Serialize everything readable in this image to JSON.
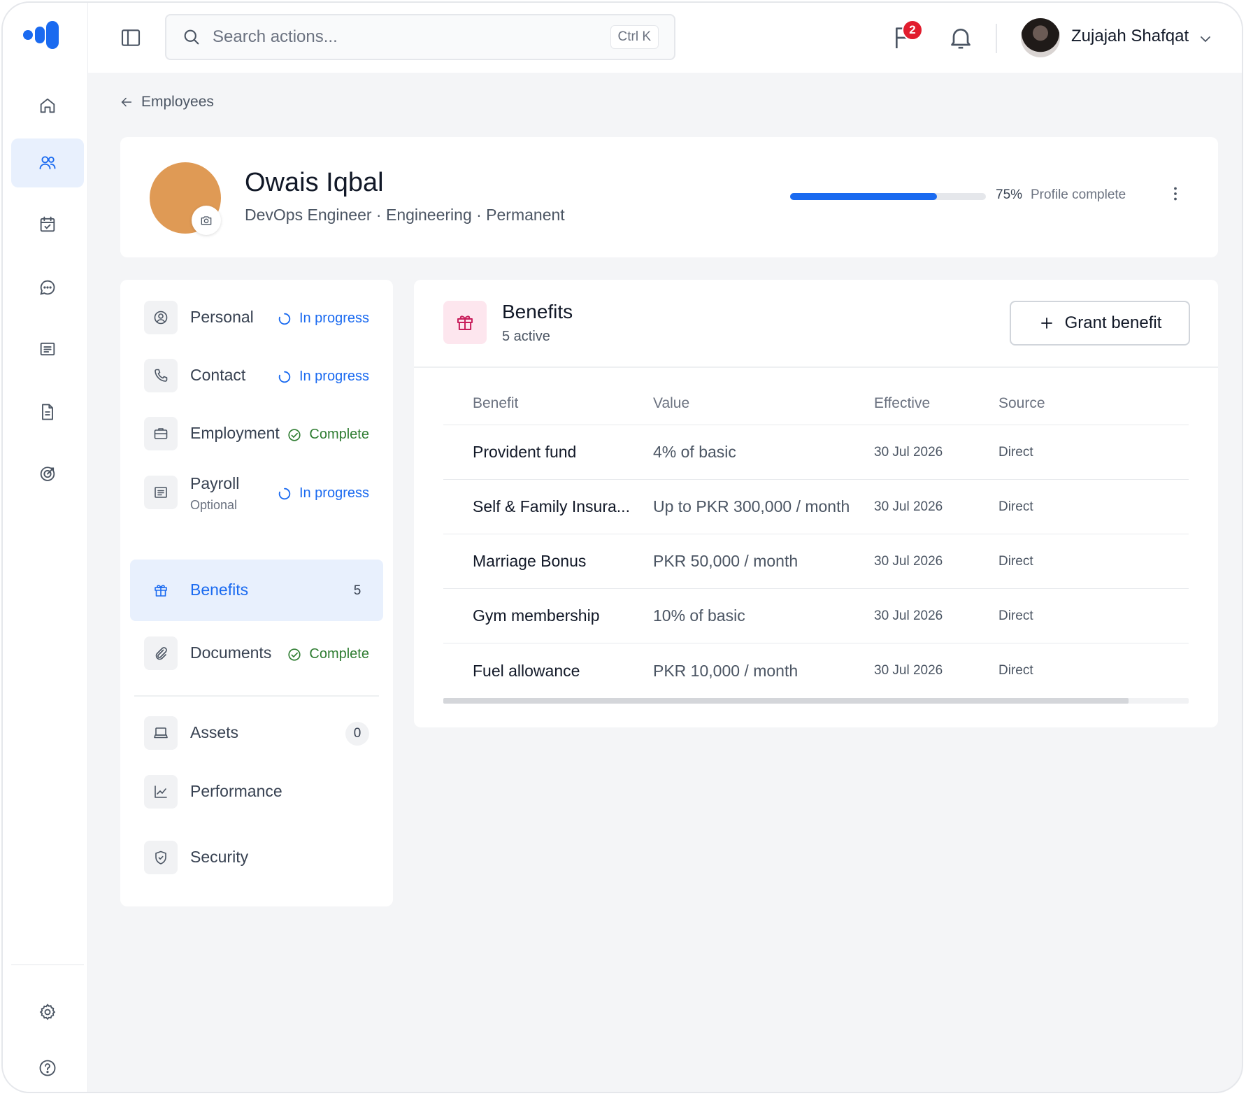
{
  "topbar": {
    "search_placeholder": "Search actions...",
    "search_shortcut": "Ctrl K",
    "notification_count": "2",
    "user_name": "Zujajah Shafqat"
  },
  "breadcrumb": {
    "label": "Employees"
  },
  "profile": {
    "name": "Owais Iqbal",
    "subtitle": "DevOps Engineer · Engineering · Permanent",
    "completion_percent": 75,
    "completion_text": "75%",
    "completion_label": "Profile complete",
    "avatar_color": "#df9a55"
  },
  "sidenav": {
    "items": [
      {
        "label": "Personal",
        "status": "In progress"
      },
      {
        "label": "Contact",
        "status": "In progress"
      },
      {
        "label": "Employment",
        "status": "Complete"
      },
      {
        "label": "Payroll",
        "sub": "Optional",
        "status": "In progress"
      },
      {
        "label": "Benefits",
        "count": "5"
      },
      {
        "label": "Documents",
        "status": "Complete"
      },
      {
        "label": "Assets",
        "count": "0"
      },
      {
        "label": "Performance"
      },
      {
        "label": "Security"
      }
    ]
  },
  "benefits": {
    "title": "Benefits",
    "subtitle": "5 active",
    "grant_label": "Grant benefit",
    "columns": [
      "Benefit",
      "Value",
      "Effective",
      "Source"
    ],
    "rows": [
      {
        "benefit": "Provident fund",
        "value": "4% of basic",
        "effective": "30 Jul 2026",
        "source": "Direct"
      },
      {
        "benefit": "Self & Family Insura...",
        "value": "Up to PKR 300,000 / month",
        "effective": "30 Jul 2026",
        "source": "Direct"
      },
      {
        "benefit": "Marriage Bonus",
        "value": "PKR 50,000 / month",
        "effective": "30 Jul 2026",
        "source": "Direct"
      },
      {
        "benefit": "Gym membership",
        "value": "10% of basic",
        "effective": "30 Jul 2026",
        "source": "Direct"
      },
      {
        "benefit": "Fuel allowance",
        "value": "PKR 10,000 / month",
        "effective": "30 Jul 2026",
        "source": "Direct"
      }
    ]
  },
  "colors": {
    "accent": "#1a6af0",
    "complete": "#2f7d32",
    "badge": "#e11d2e",
    "benefit_icon_bg": "#fde6ee"
  }
}
